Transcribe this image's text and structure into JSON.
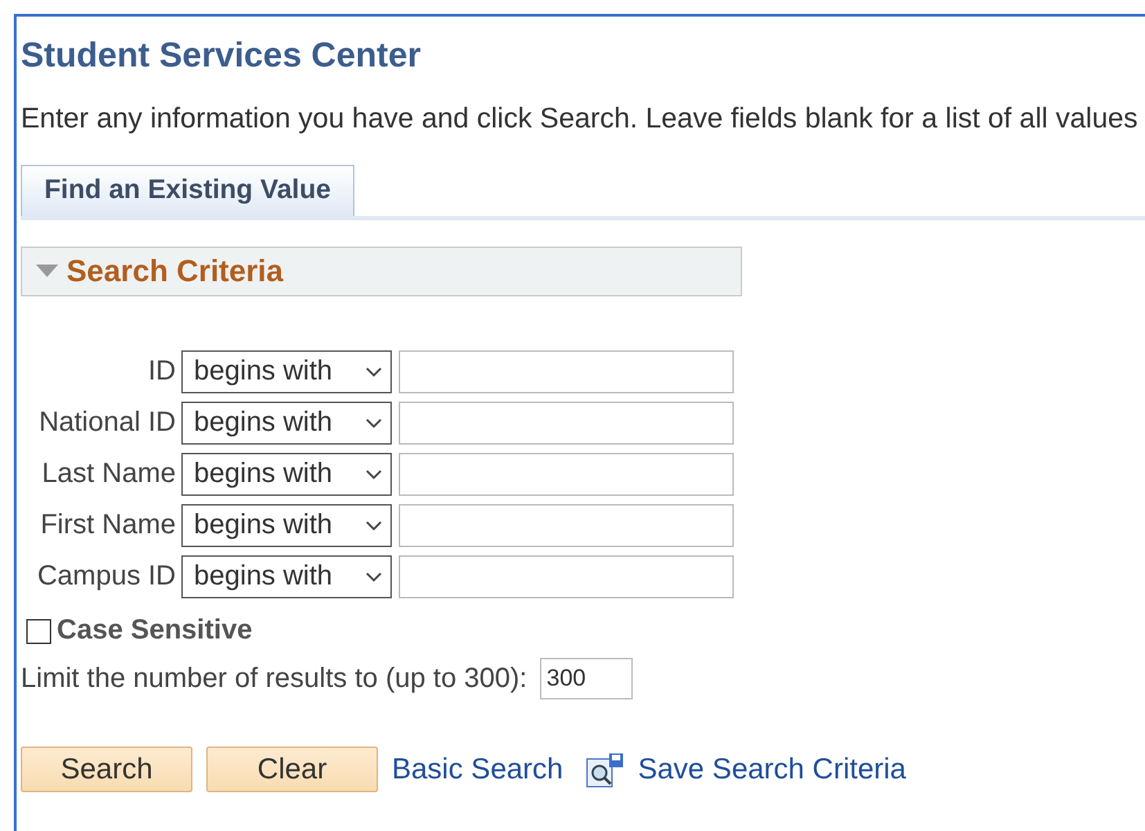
{
  "title": "Student Services Center",
  "instructions": "Enter any information you have and click Search. Leave fields blank for a list of all values",
  "tabs": [
    {
      "label": "Find an Existing Value",
      "selected": true
    }
  ],
  "section": {
    "title": "Search Criteria",
    "expanded": true
  },
  "fields": [
    {
      "label": "ID",
      "operator": "begins with"
    },
    {
      "label": "National ID",
      "operator": "begins with"
    },
    {
      "label": "Last Name",
      "operator": "begins with"
    },
    {
      "label": "First Name",
      "operator": "begins with"
    },
    {
      "label": "Campus ID",
      "operator": "begins with"
    }
  ],
  "case_sensitive": {
    "label": "Case Sensitive",
    "checked": false
  },
  "limit": {
    "label": "Limit the number of results to (up to 300):",
    "value": "300"
  },
  "buttons": [
    "Search",
    "Clear"
  ],
  "links": [
    {
      "label": "Basic Search",
      "kind": "link"
    },
    {
      "label": "Save Search Criteria",
      "kind": "save"
    }
  ]
}
